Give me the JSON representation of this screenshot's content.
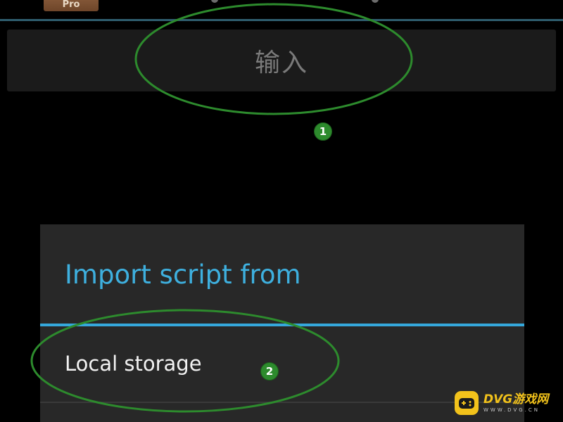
{
  "header": {
    "app_icon_text": "Pro"
  },
  "input_bar": {
    "label": "输入"
  },
  "dialog": {
    "title": "Import script from",
    "items": [
      {
        "label": "Local storage"
      }
    ]
  },
  "annotations": {
    "markers": [
      "1",
      "2"
    ],
    "color": "#2d8b2d"
  },
  "watermark": {
    "text": "DVG游戏网",
    "sub": "WWW.DVG.CN",
    "color": "#f2c21b"
  },
  "colors": {
    "background": "#000000",
    "accent": "#35a8dc",
    "dialog_bg": "#282828",
    "input_bg": "#1b1b1b"
  }
}
